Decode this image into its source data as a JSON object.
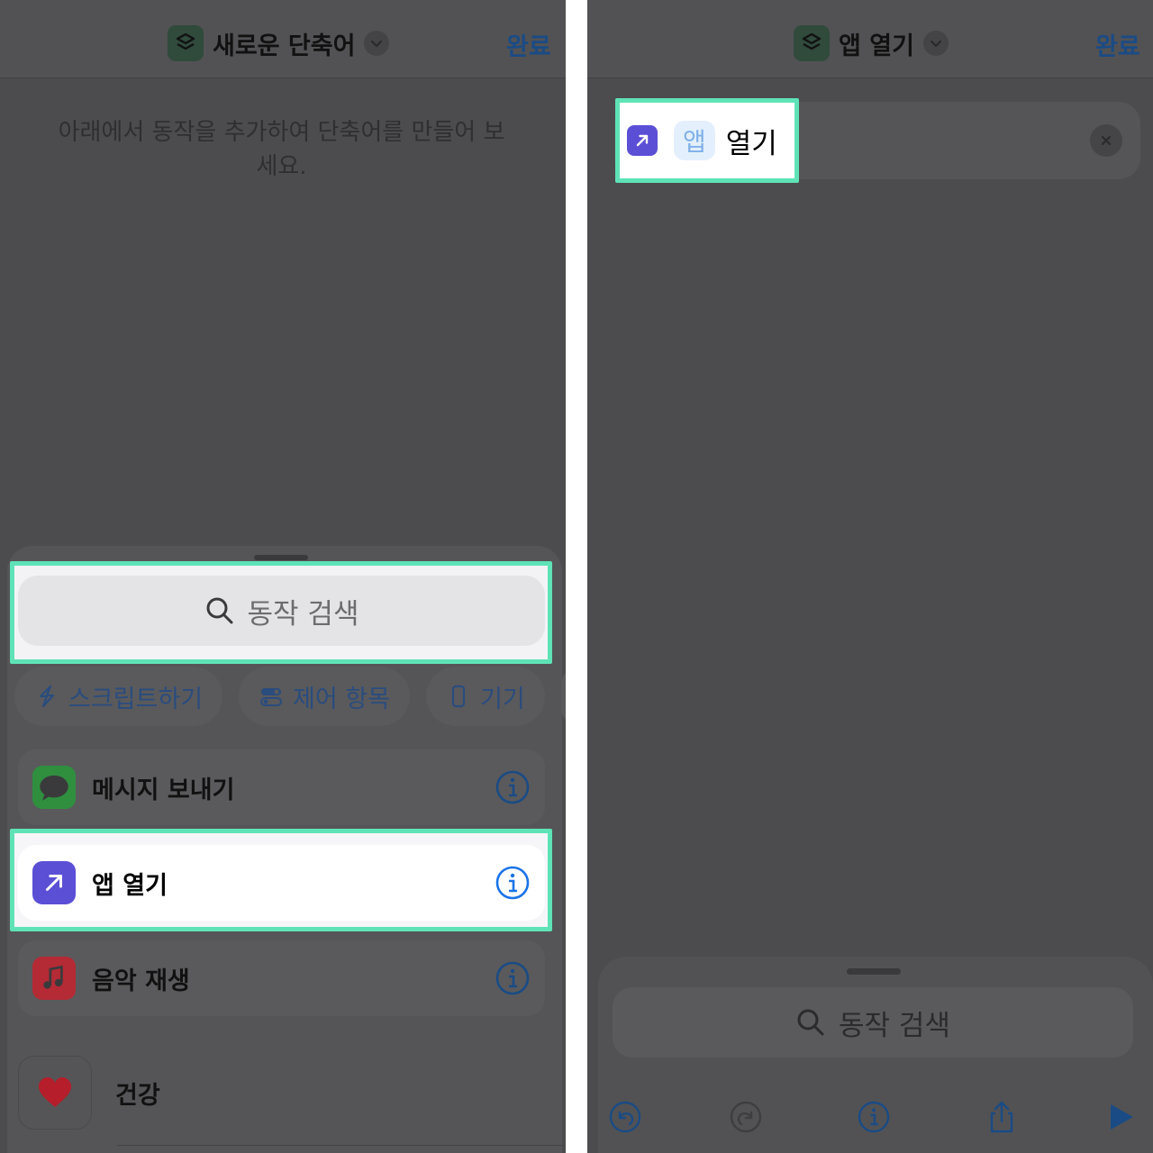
{
  "left": {
    "nav": {
      "title": "새로운 단축어",
      "done": "완료"
    },
    "hint": "아래에서 동작을 추가하여 단축어를 만들어 보세요.",
    "search_placeholder": "동작 검색",
    "chips": [
      {
        "label": "스크립트하기",
        "icon": "scripting-icon"
      },
      {
        "label": "제어 항목",
        "icon": "toggle-icon"
      },
      {
        "label": "기기",
        "icon": "phone-icon"
      }
    ],
    "actions": [
      {
        "label": "메시지 보내기",
        "icon": "messages-icon"
      },
      {
        "label": "앱 열기",
        "icon": "open-app-icon"
      },
      {
        "label": "음악 재생",
        "icon": "music-icon"
      }
    ],
    "health": "건강"
  },
  "right": {
    "nav": {
      "title": "앱 열기",
      "done": "완료"
    },
    "action": {
      "token": "앱",
      "label": "열기"
    },
    "search_placeholder": "동작 검색",
    "toolbar": [
      "undo-icon",
      "redo-icon",
      "info-icon",
      "share-icon",
      "play-icon"
    ]
  },
  "colors": {
    "accent": "#1a73e8",
    "highlight": "#5fe3b6",
    "open_app_purple": "#5b4fd6",
    "messages_green": "#2f8f3f",
    "music_red": "#b42a35"
  }
}
